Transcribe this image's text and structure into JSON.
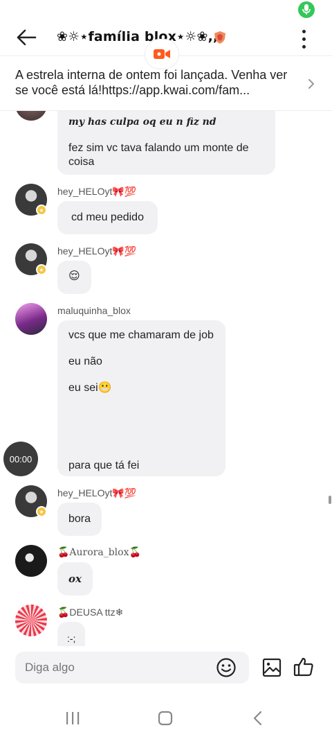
{
  "header": {
    "title": "❀☼⋆família blox⋆☼❀,,",
    "badge_icon": "shield-badge-icon"
  },
  "announcement": {
    "text": "A estrela interna de ontem foi lançada. Venha ver se você está lá!https://app.kwai.com/fam..."
  },
  "messages": [
    {
      "id": "m1",
      "username": "",
      "lines": [
        "my has culpa oq eu n fiz nd",
        "fez sim vc tava falando um monte de coisa"
      ]
    },
    {
      "id": "m2",
      "username": "hey_HELOyt🎀💯",
      "lines": [
        "cd meu pedido"
      ]
    },
    {
      "id": "m3",
      "username": "hey_HELOyt🎀💯",
      "lines": [
        "😌"
      ]
    },
    {
      "id": "m4",
      "username": "maluquinha_blox",
      "lines": [
        "vcs que me chamaram de job",
        "eu não",
        "eu sei😬",
        "para que tá fei"
      ]
    },
    {
      "id": "m5",
      "username": "hey_HELOyt🎀💯",
      "lines": [
        "bora"
      ]
    },
    {
      "id": "m6",
      "username": "🍒Aurora_blox🍒",
      "lines": [
        "ox"
      ]
    },
    {
      "id": "m7",
      "username": "🍒DEUSA ttz❄",
      "lines": [
        ":-;"
      ]
    }
  ],
  "recording": {
    "timer": "00:00"
  },
  "composer": {
    "placeholder": "Diga algo"
  },
  "colors": {
    "accent": "#ff5a1f",
    "mic_green": "#34c759",
    "bubble_bg": "#f1f1f3"
  }
}
